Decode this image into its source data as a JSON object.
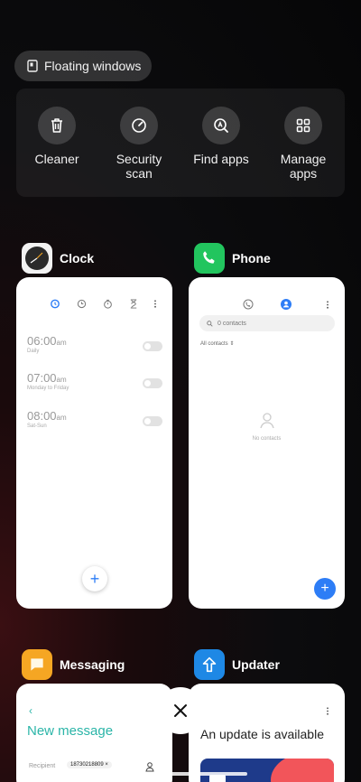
{
  "floating_windows": {
    "label": "Floating windows",
    "icon": "floating-window-icon"
  },
  "tools": [
    {
      "label": "Cleaner",
      "icon": "trash-icon"
    },
    {
      "label": "Security scan",
      "icon": "gauge-icon"
    },
    {
      "label": "Find apps",
      "icon": "find-apps-icon"
    },
    {
      "label": "Manage apps",
      "icon": "grid-icon"
    }
  ],
  "apps": {
    "clock": {
      "name": "Clock",
      "alarms": [
        {
          "time": "06:00",
          "ampm": "am",
          "repeat": "Daily"
        },
        {
          "time": "07:00",
          "ampm": "am",
          "repeat": "Monday to Friday"
        },
        {
          "time": "08:00",
          "ampm": "am",
          "repeat": "Sat-Sun"
        }
      ],
      "add": "+"
    },
    "phone": {
      "name": "Phone",
      "search_placeholder": "0 contacts",
      "filter": "All contacts",
      "empty": "No contacts",
      "add": "+"
    },
    "messaging": {
      "name": "Messaging",
      "title": "New message",
      "recipient_label": "Recipient",
      "recipient_value": "18730218809"
    },
    "updater": {
      "name": "Updater",
      "title": "An update is available"
    }
  },
  "colors": {
    "accent_blue": "#2d7df6",
    "phone_green": "#22c55e",
    "messaging_orange": "#f5a623",
    "updater_blue": "#1e88e5",
    "messaging_teal": "#2bb5a8"
  }
}
